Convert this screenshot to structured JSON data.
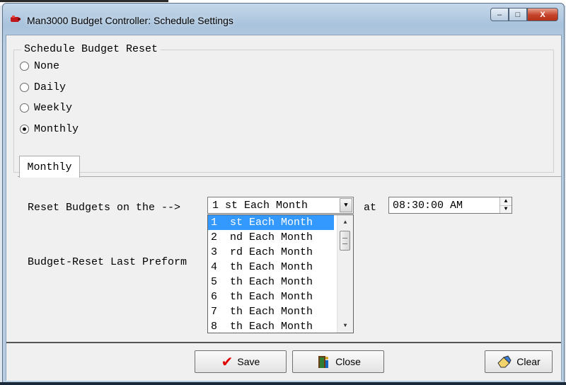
{
  "window": {
    "title": "Man3000 Budget Controller: Schedule Settings",
    "controls": {
      "minimize": "–",
      "maximize": "□",
      "close": "X"
    }
  },
  "schedule": {
    "legend": "Schedule Budget Reset",
    "options": [
      {
        "label": "None",
        "checked": false
      },
      {
        "label": "Daily",
        "checked": false
      },
      {
        "label": "Weekly",
        "checked": false
      },
      {
        "label": "Monthly",
        "checked": true
      }
    ]
  },
  "tab": {
    "label": "Monthly"
  },
  "reset": {
    "label": "Reset Budgets on the -->",
    "selected": "1  st Each Month",
    "at_label": "at",
    "time": "08:30:00 AM"
  },
  "last": {
    "label": "Budget-Reset Last Preform",
    "link_fragment": "e"
  },
  "dropdown": {
    "items": [
      "1  st Each Month",
      "2  nd Each Month",
      "3  rd Each Month",
      "4  th Each Month",
      "5  th Each Month",
      "6  th Each Month",
      "7  th Each Month",
      "8  th Each Month"
    ],
    "selected_index": 0
  },
  "buttons": {
    "save": "Save",
    "close": "Close",
    "clear": "Clear"
  },
  "colors": {
    "selection": "#3399ff",
    "save_check": "#e00000",
    "close_icon": "#6a3c12",
    "link": "#1a3fd0"
  }
}
